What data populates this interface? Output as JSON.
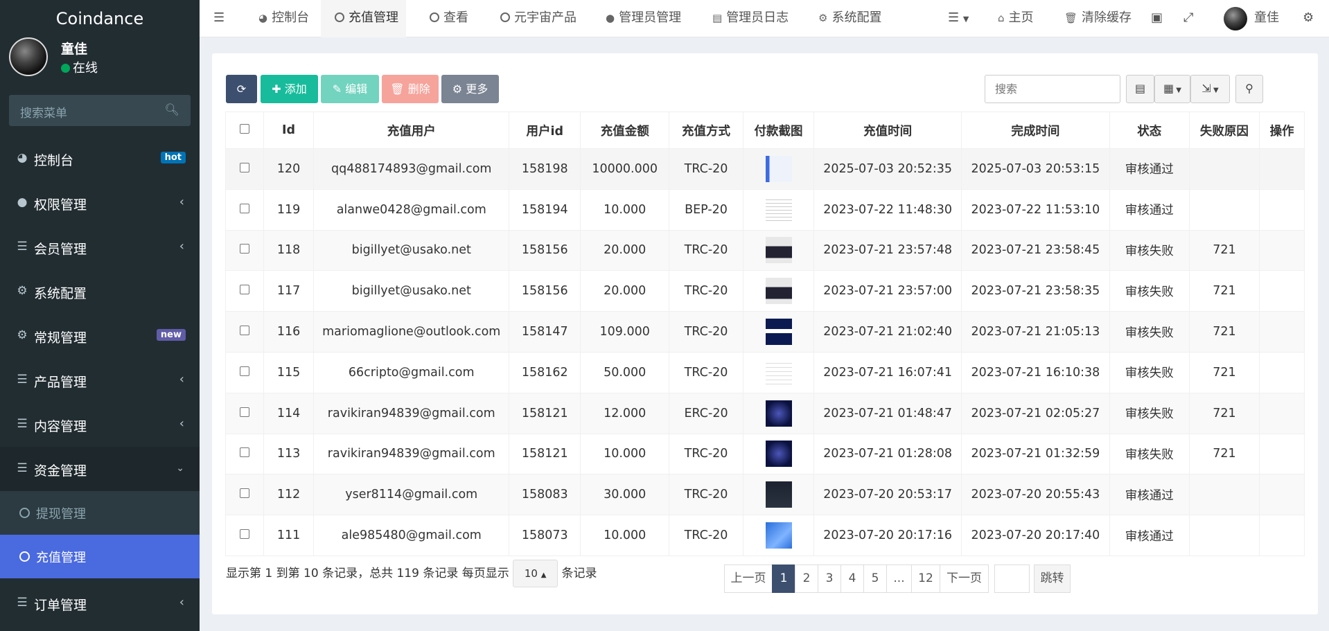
{
  "brand": "Coindance",
  "user": {
    "name": "童佳",
    "status": "在线"
  },
  "sidebar": {
    "search_placeholder": "搜索菜单",
    "items": [
      {
        "label": "控制台",
        "icon": "dashboard-icon",
        "badge": "hot"
      },
      {
        "label": "权限管理",
        "icon": "users-icon"
      },
      {
        "label": "会员管理",
        "icon": "list-icon"
      },
      {
        "label": "系统配置",
        "icon": "gear-icon"
      },
      {
        "label": "常规管理",
        "icon": "gears-icon",
        "badge": "new"
      },
      {
        "label": "产品管理",
        "icon": "list-icon"
      },
      {
        "label": "内容管理",
        "icon": "list-icon"
      },
      {
        "label": "资金管理",
        "icon": "list-icon"
      }
    ],
    "sub_items": [
      {
        "label": "提现管理"
      },
      {
        "label": "充值管理"
      }
    ],
    "bottom_item": {
      "label": "订单管理",
      "icon": "list-icon"
    }
  },
  "topnav": {
    "tabs": [
      {
        "label": "控制台"
      },
      {
        "label": "充值管理"
      },
      {
        "label": "查看"
      },
      {
        "label": "元宇宙产品"
      },
      {
        "label": "管理员管理"
      },
      {
        "label": "管理员日志"
      },
      {
        "label": "系统配置"
      }
    ],
    "home": "主页",
    "clear_cache": "清除缓存",
    "user_name": "童佳"
  },
  "toolbar": {
    "add": "添加",
    "edit": "编辑",
    "delete": "删除",
    "more": "更多",
    "search_placeholder": "搜索"
  },
  "table": {
    "columns": [
      "Id",
      "充值用户",
      "用户id",
      "充值金额",
      "充值方式",
      "付款截图",
      "充值时间",
      "完成时间",
      "状态",
      "失败原因",
      "操作"
    ],
    "rows": [
      {
        "id": "120",
        "user": "qq488174893@gmail.com",
        "uid": "158198",
        "amount": "10000.000",
        "method": "TRC-20",
        "created": "2025-07-03 20:52:35",
        "done": "2025-07-03 20:53:15",
        "status": "审核通过",
        "reason": ""
      },
      {
        "id": "119",
        "user": "alanwe0428@gmail.com",
        "uid": "158194",
        "amount": "10.000",
        "method": "BEP-20",
        "created": "2023-07-22 11:48:30",
        "done": "2023-07-22 11:53:10",
        "status": "审核通过",
        "reason": ""
      },
      {
        "id": "118",
        "user": "bigillyet@usako.net",
        "uid": "158156",
        "amount": "20.000",
        "method": "TRC-20",
        "created": "2023-07-21 23:57:48",
        "done": "2023-07-21 23:58:45",
        "status": "审核失败",
        "reason": "721"
      },
      {
        "id": "117",
        "user": "bigillyet@usako.net",
        "uid": "158156",
        "amount": "20.000",
        "method": "TRC-20",
        "created": "2023-07-21 23:57:00",
        "done": "2023-07-21 23:58:35",
        "status": "审核失败",
        "reason": "721"
      },
      {
        "id": "116",
        "user": "mariomaglione@outlook.com",
        "uid": "158147",
        "amount": "109.000",
        "method": "TRC-20",
        "created": "2023-07-21 21:02:40",
        "done": "2023-07-21 21:05:13",
        "status": "审核失败",
        "reason": "721"
      },
      {
        "id": "115",
        "user": "66cripto@gmail.com",
        "uid": "158162",
        "amount": "50.000",
        "method": "TRC-20",
        "created": "2023-07-21 16:07:41",
        "done": "2023-07-21 16:10:38",
        "status": "审核失败",
        "reason": "721"
      },
      {
        "id": "114",
        "user": "ravikiran94839@gmail.com",
        "uid": "158121",
        "amount": "12.000",
        "method": "ERC-20",
        "created": "2023-07-21 01:48:47",
        "done": "2023-07-21 02:05:27",
        "status": "审核失败",
        "reason": "721"
      },
      {
        "id": "113",
        "user": "ravikiran94839@gmail.com",
        "uid": "158121",
        "amount": "10.000",
        "method": "TRC-20",
        "created": "2023-07-21 01:28:08",
        "done": "2023-07-21 01:32:59",
        "status": "审核失败",
        "reason": "721"
      },
      {
        "id": "112",
        "user": "yser8114@gmail.com",
        "uid": "158083",
        "amount": "30.000",
        "method": "TRC-20",
        "created": "2023-07-20 20:53:17",
        "done": "2023-07-20 20:55:43",
        "status": "审核通过",
        "reason": ""
      },
      {
        "id": "111",
        "user": "ale985480@gmail.com",
        "uid": "158073",
        "amount": "10.000",
        "method": "TRC-20",
        "created": "2023-07-20 20:17:16",
        "done": "2023-07-20 20:17:40",
        "status": "审核通过",
        "reason": ""
      }
    ]
  },
  "footer": {
    "info_prefix": "显示第 1 到第 10 条记录，总共 119 条记录 每页显示",
    "page_size": "10",
    "info_suffix": "条记录",
    "prev": "上一页",
    "pages": [
      "1",
      "2",
      "3",
      "4",
      "5",
      "...",
      "12"
    ],
    "next": "下一页",
    "jump": "跳转"
  },
  "colors": {
    "sidebar_bg": "#222d32",
    "active_blue": "#4a6ae0",
    "success": "#18bc9c",
    "danger": "#e74c3c"
  }
}
